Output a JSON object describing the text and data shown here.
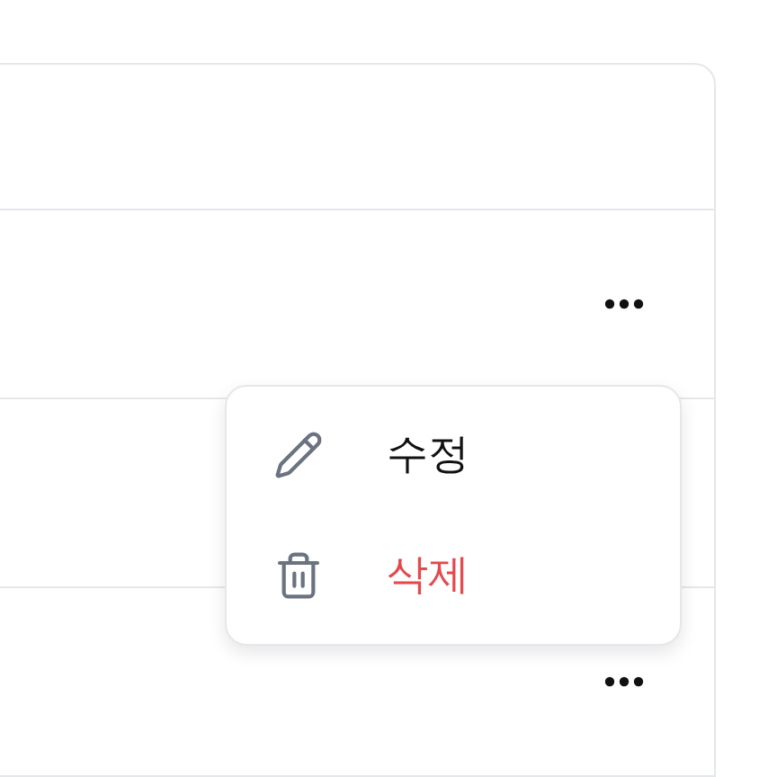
{
  "rows": [
    {
      "menu_open": true
    },
    {
      "menu_open": false
    },
    {
      "menu_open": false
    }
  ],
  "menu": {
    "items": [
      {
        "kind": "edit",
        "label": "수정"
      },
      {
        "kind": "delete",
        "label": "삭제"
      }
    ]
  }
}
